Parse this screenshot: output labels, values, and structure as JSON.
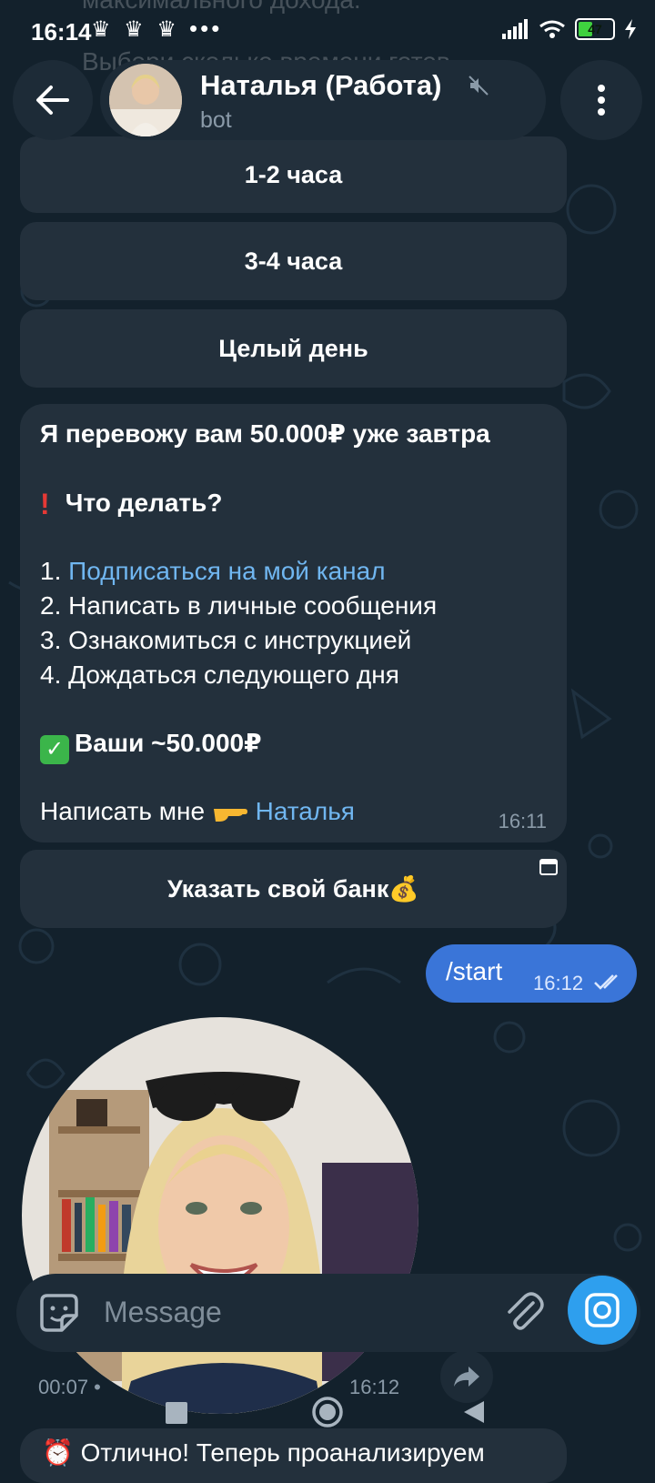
{
  "status_bar": {
    "time": "16:14",
    "notif_icons": "♛ ♛ ♛",
    "dots": "•••",
    "battery": "47"
  },
  "background_text": {
    "top_line": "максимального дохода.",
    "second_line": "Выбери сколько времени готов"
  },
  "header": {
    "title": "Наталья (Работа)",
    "subtitle": "bot"
  },
  "keyboard_top": [
    {
      "label": "1-2 часа"
    },
    {
      "label": "3-4 часа"
    },
    {
      "label": "Целый день"
    }
  ],
  "message": {
    "headline": "Я перевожу вам 50.000₽ уже завтра",
    "question": "Что делать?",
    "steps": [
      {
        "num": "1.",
        "text": "Подписаться на мой канал"
      },
      {
        "num": "2.",
        "text": "Написать в личные сообщения"
      },
      {
        "num": "3.",
        "text": "Ознакомиться с инструкцией"
      },
      {
        "num": "4.",
        "text": "Дождаться следующего дня"
      }
    ],
    "reward": "Ваши ~50.000₽",
    "contact_prefix": "Написать мне",
    "contact_link": "Наталья",
    "time": "16:11"
  },
  "inline_button": {
    "label": "Указать свой банк💰"
  },
  "outgoing": {
    "text": "/start",
    "time": "16:12"
  },
  "video_note": {
    "duration": "00:07",
    "time": "16:12"
  },
  "bottom_message": {
    "text": "Отлично! Теперь проанализируем"
  },
  "input": {
    "placeholder": "Message"
  },
  "colors": {
    "background": "#13212c",
    "bubble": "#23303c",
    "outgoing": "#3a75d8",
    "link": "#70b6f0",
    "camera": "#2e9fee"
  },
  "icons": {
    "back": "arrow-left-icon",
    "mute": "muted-speaker-icon",
    "more": "more-vertical-icon",
    "sticker": "sticker-icon",
    "attach": "paperclip-icon",
    "camera": "camera-icon",
    "read": "double-check-icon",
    "forward": "forward-icon"
  }
}
